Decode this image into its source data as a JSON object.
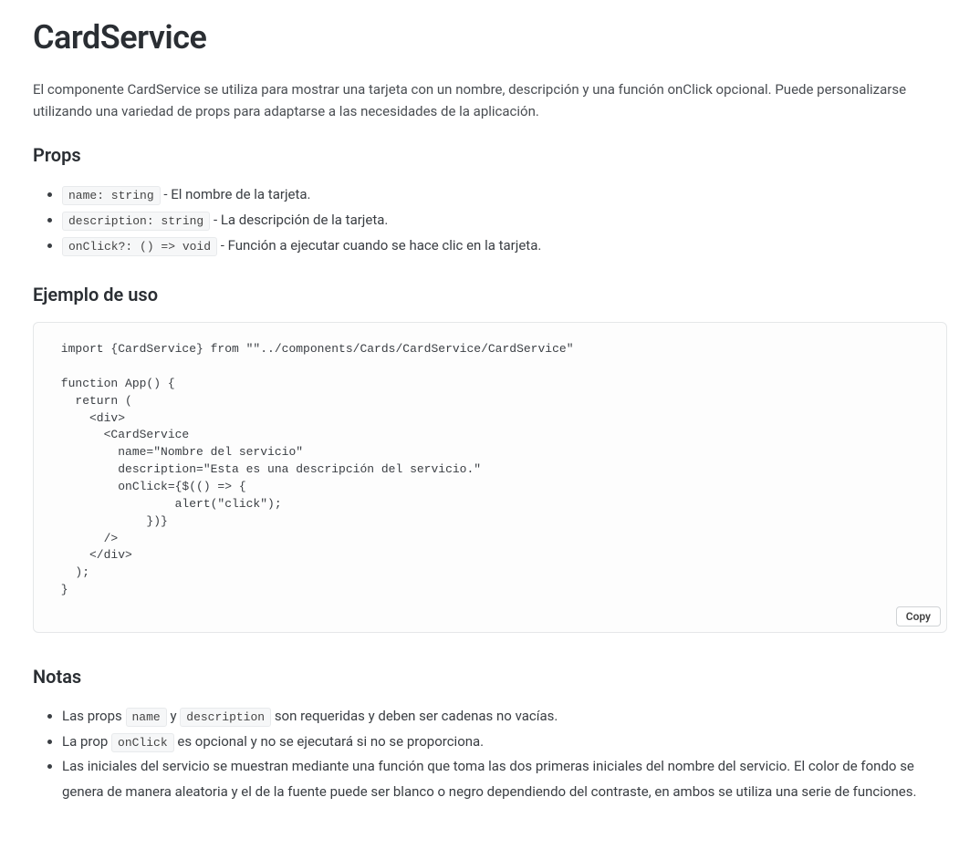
{
  "title": "CardService",
  "intro": "El componente CardService se utiliza para mostrar una tarjeta con un nombre, descripción y una función onClick opcional. Puede personalizarse utilizando una variedad de props para adaptarse a las necesidades de la aplicación.",
  "props_heading": "Props",
  "props": [
    {
      "sig": "name: string",
      "desc": " - El nombre de la tarjeta."
    },
    {
      "sig": "description: string",
      "desc": " - La descripción de la tarjeta."
    },
    {
      "sig": "onClick?: () => void",
      "desc": " - Función a ejecutar cuando se hace clic en la tarjeta."
    }
  ],
  "example_heading": "Ejemplo de uso",
  "code": " import {CardService} from \"\"../components/Cards/CardService/CardService\"\n\n function App() {\n   return (\n     <div>\n       <CardService\n         name=\"Nombre del servicio\"\n         description=\"Esta es una descripción del servicio.\"\n         onClick={$(() => {\n                 alert(\"click\");\n             })}\n       />\n     </div>\n   );\n }",
  "copy_label": "Copy",
  "notes_heading": "Notas",
  "notes": [
    {
      "parts": [
        {
          "t": "text",
          "v": "Las props "
        },
        {
          "t": "code",
          "v": "name"
        },
        {
          "t": "text",
          "v": " y "
        },
        {
          "t": "code",
          "v": "description"
        },
        {
          "t": "text",
          "v": " son requeridas y deben ser cadenas no vacías."
        }
      ]
    },
    {
      "parts": [
        {
          "t": "text",
          "v": "La prop "
        },
        {
          "t": "code",
          "v": "onClick"
        },
        {
          "t": "text",
          "v": " es opcional y no se ejecutará si no se proporciona."
        }
      ]
    },
    {
      "parts": [
        {
          "t": "text",
          "v": "Las iniciales del servicio se muestran mediante una función que toma las dos primeras iniciales del nombre del servicio. El color de fondo se genera de manera aleatoria y el de la fuente puede ser blanco o negro dependiendo del contraste, en ambos se utiliza una serie de funciones."
        }
      ]
    }
  ]
}
